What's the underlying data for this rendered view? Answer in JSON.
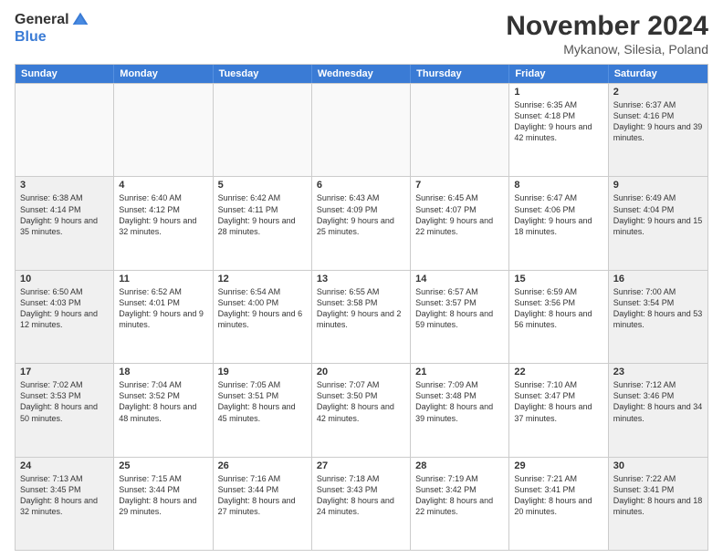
{
  "logo": {
    "general": "General",
    "blue": "Blue"
  },
  "title": "November 2024",
  "location": "Mykanow, Silesia, Poland",
  "days_of_week": [
    "Sunday",
    "Monday",
    "Tuesday",
    "Wednesday",
    "Thursday",
    "Friday",
    "Saturday"
  ],
  "weeks": [
    [
      {
        "day": "",
        "empty": true
      },
      {
        "day": "",
        "empty": true
      },
      {
        "day": "",
        "empty": true
      },
      {
        "day": "",
        "empty": true
      },
      {
        "day": "",
        "empty": true
      },
      {
        "day": "1",
        "sunrise": "6:35 AM",
        "sunset": "4:18 PM",
        "daylight": "9 hours and 42 minutes."
      },
      {
        "day": "2",
        "sunrise": "6:37 AM",
        "sunset": "4:16 PM",
        "daylight": "9 hours and 39 minutes."
      }
    ],
    [
      {
        "day": "3",
        "sunrise": "6:38 AM",
        "sunset": "4:14 PM",
        "daylight": "9 hours and 35 minutes."
      },
      {
        "day": "4",
        "sunrise": "6:40 AM",
        "sunset": "4:12 PM",
        "daylight": "9 hours and 32 minutes."
      },
      {
        "day": "5",
        "sunrise": "6:42 AM",
        "sunset": "4:11 PM",
        "daylight": "9 hours and 28 minutes."
      },
      {
        "day": "6",
        "sunrise": "6:43 AM",
        "sunset": "4:09 PM",
        "daylight": "9 hours and 25 minutes."
      },
      {
        "day": "7",
        "sunrise": "6:45 AM",
        "sunset": "4:07 PM",
        "daylight": "9 hours and 22 minutes."
      },
      {
        "day": "8",
        "sunrise": "6:47 AM",
        "sunset": "4:06 PM",
        "daylight": "9 hours and 18 minutes."
      },
      {
        "day": "9",
        "sunrise": "6:49 AM",
        "sunset": "4:04 PM",
        "daylight": "9 hours and 15 minutes."
      }
    ],
    [
      {
        "day": "10",
        "sunrise": "6:50 AM",
        "sunset": "4:03 PM",
        "daylight": "9 hours and 12 minutes."
      },
      {
        "day": "11",
        "sunrise": "6:52 AM",
        "sunset": "4:01 PM",
        "daylight": "9 hours and 9 minutes."
      },
      {
        "day": "12",
        "sunrise": "6:54 AM",
        "sunset": "4:00 PM",
        "daylight": "9 hours and 6 minutes."
      },
      {
        "day": "13",
        "sunrise": "6:55 AM",
        "sunset": "3:58 PM",
        "daylight": "9 hours and 2 minutes."
      },
      {
        "day": "14",
        "sunrise": "6:57 AM",
        "sunset": "3:57 PM",
        "daylight": "8 hours and 59 minutes."
      },
      {
        "day": "15",
        "sunrise": "6:59 AM",
        "sunset": "3:56 PM",
        "daylight": "8 hours and 56 minutes."
      },
      {
        "day": "16",
        "sunrise": "7:00 AM",
        "sunset": "3:54 PM",
        "daylight": "8 hours and 53 minutes."
      }
    ],
    [
      {
        "day": "17",
        "sunrise": "7:02 AM",
        "sunset": "3:53 PM",
        "daylight": "8 hours and 50 minutes."
      },
      {
        "day": "18",
        "sunrise": "7:04 AM",
        "sunset": "3:52 PM",
        "daylight": "8 hours and 48 minutes."
      },
      {
        "day": "19",
        "sunrise": "7:05 AM",
        "sunset": "3:51 PM",
        "daylight": "8 hours and 45 minutes."
      },
      {
        "day": "20",
        "sunrise": "7:07 AM",
        "sunset": "3:50 PM",
        "daylight": "8 hours and 42 minutes."
      },
      {
        "day": "21",
        "sunrise": "7:09 AM",
        "sunset": "3:48 PM",
        "daylight": "8 hours and 39 minutes."
      },
      {
        "day": "22",
        "sunrise": "7:10 AM",
        "sunset": "3:47 PM",
        "daylight": "8 hours and 37 minutes."
      },
      {
        "day": "23",
        "sunrise": "7:12 AM",
        "sunset": "3:46 PM",
        "daylight": "8 hours and 34 minutes."
      }
    ],
    [
      {
        "day": "24",
        "sunrise": "7:13 AM",
        "sunset": "3:45 PM",
        "daylight": "8 hours and 32 minutes."
      },
      {
        "day": "25",
        "sunrise": "7:15 AM",
        "sunset": "3:44 PM",
        "daylight": "8 hours and 29 minutes."
      },
      {
        "day": "26",
        "sunrise": "7:16 AM",
        "sunset": "3:44 PM",
        "daylight": "8 hours and 27 minutes."
      },
      {
        "day": "27",
        "sunrise": "7:18 AM",
        "sunset": "3:43 PM",
        "daylight": "8 hours and 24 minutes."
      },
      {
        "day": "28",
        "sunrise": "7:19 AM",
        "sunset": "3:42 PM",
        "daylight": "8 hours and 22 minutes."
      },
      {
        "day": "29",
        "sunrise": "7:21 AM",
        "sunset": "3:41 PM",
        "daylight": "8 hours and 20 minutes."
      },
      {
        "day": "30",
        "sunrise": "7:22 AM",
        "sunset": "3:41 PM",
        "daylight": "8 hours and 18 minutes."
      }
    ]
  ]
}
